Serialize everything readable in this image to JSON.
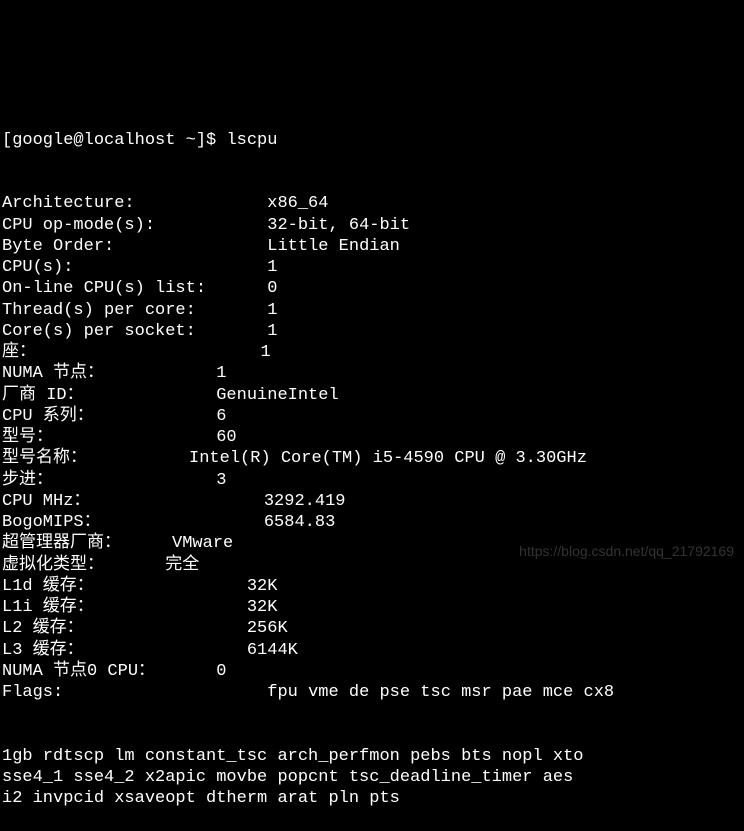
{
  "prompt": "[google@localhost ~]$ ",
  "command": "lscpu",
  "lines": [
    {
      "label": "Architecture:",
      "value": "x86_64",
      "col": 26
    },
    {
      "label": "CPU op-mode(s):",
      "value": "32-bit, 64-bit",
      "col": 26
    },
    {
      "label": "Byte Order:",
      "value": "Little Endian",
      "col": 26
    },
    {
      "label": "CPU(s):",
      "value": "1",
      "col": 26
    },
    {
      "label": "On-line CPU(s) list:",
      "value": "0",
      "col": 26
    },
    {
      "label": "Thread(s) per core:",
      "value": "1",
      "col": 26
    },
    {
      "label": "Core(s) per socket:",
      "value": "1",
      "col": 26
    },
    {
      "label": "座：",
      "value": "1",
      "col": 26
    },
    {
      "label": "NUMA 节点：",
      "value": "1",
      "col": 22
    },
    {
      "label": "厂商 ID：",
      "value": "GenuineIntel",
      "col": 22
    },
    {
      "label": "CPU 系列：",
      "value": "6",
      "col": 22
    },
    {
      "label": "型号：",
      "value": "60",
      "col": 22
    },
    {
      "label": "型号名称：",
      "value": "Intel(R) Core(TM) i5-4590 CPU @ 3.30GHz",
      "col": 20
    },
    {
      "label": "步进：",
      "value": "3",
      "col": 22
    },
    {
      "label": "CPU MHz：",
      "value": "3292.419",
      "col": 26
    },
    {
      "label": "BogoMIPS：",
      "value": "6584.83",
      "col": 26
    },
    {
      "label": "超管理器厂商：",
      "value": "VMware",
      "col": 19
    },
    {
      "label": "虚拟化类型：",
      "value": "完全",
      "col": 18
    },
    {
      "label": "L1d 缓存：",
      "value": "32K",
      "col": 25
    },
    {
      "label": "L1i 缓存：",
      "value": "32K",
      "col": 25
    },
    {
      "label": "L2 缓存：",
      "value": "256K",
      "col": 25
    },
    {
      "label": "L3 缓存：",
      "value": "6144K",
      "col": 25
    },
    {
      "label": "NUMA 节点0 CPU：",
      "value": "0",
      "col": 22
    },
    {
      "label": "Flags:",
      "value": "fpu vme de pse tsc msr pae mce cx8",
      "col": 26
    }
  ],
  "flags_cont": [
    "1gb rdtscp lm constant_tsc arch_perfmon pebs bts nopl xto",
    "sse4_1 sse4_2 x2apic movbe popcnt tsc_deadline_timer aes ",
    "i2 invpcid xsaveopt dtherm arat pln pts"
  ],
  "watermark": "https://blog.csdn.net/qq_21792169"
}
